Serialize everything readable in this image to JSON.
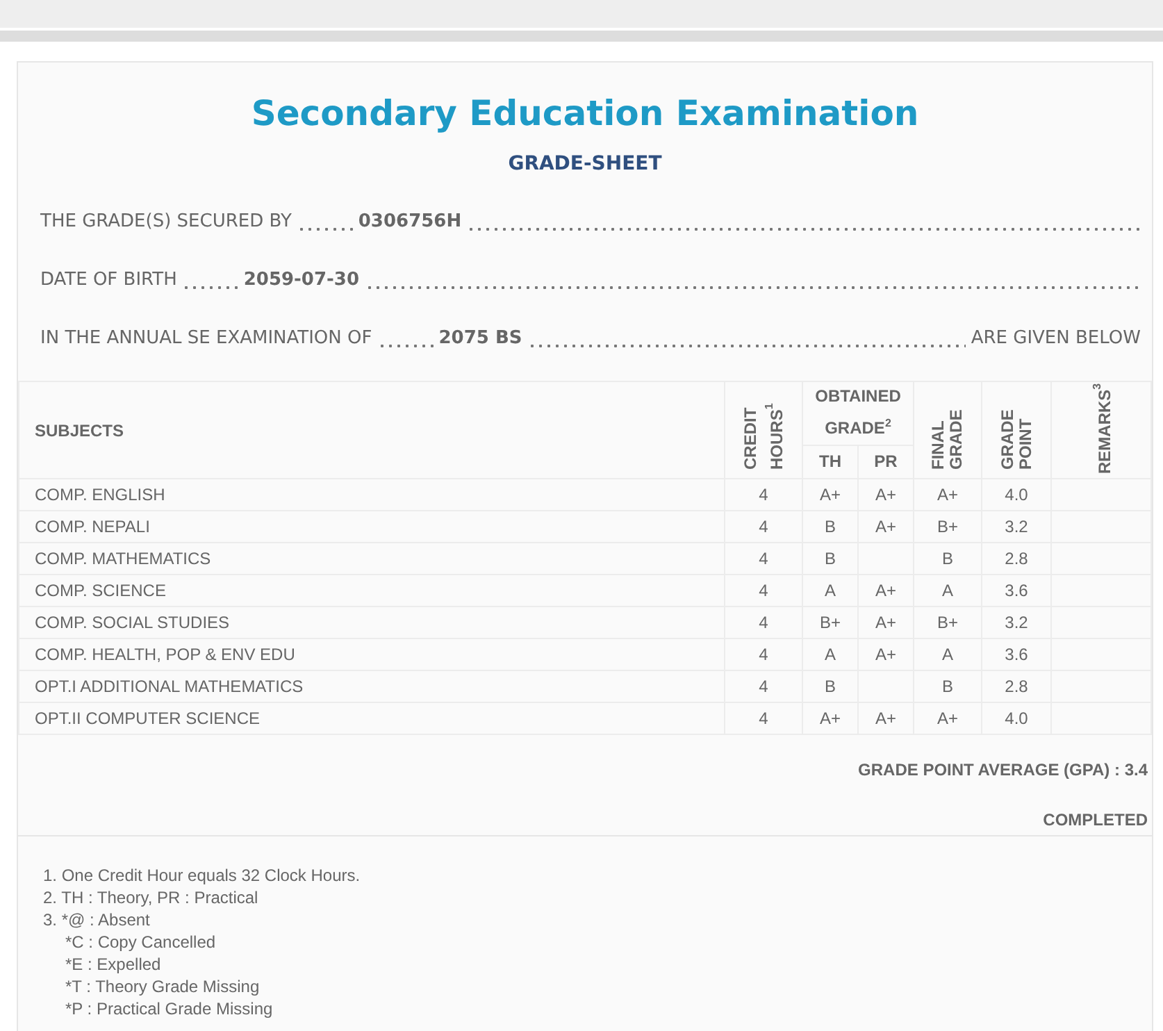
{
  "title": "Secondary Education Examination",
  "subtitle": "GRADE-SHEET",
  "info_lines": [
    {
      "label": "THE GRADE(S) SECURED BY",
      "value": "0306756H"
    },
    {
      "label": "DATE OF BIRTH",
      "value": "2059-07-30"
    },
    {
      "label": "IN THE ANNUAL SE EXAMINATION OF",
      "value": "2075 BS",
      "suffix": "ARE GIVEN BELOW"
    }
  ],
  "table": {
    "columns": {
      "subjects": "SUBJECTS",
      "credit_hours": "CREDIT HOURS$^{1}$",
      "obtained_grade": "OBTAINED GRADE$^{2}$",
      "th": "TH",
      "pr": "PR",
      "final_grade": "FINAL GRADE",
      "grade_point": "GRADE POINT",
      "remarks": "REMARKS$^{3}$"
    },
    "rows": [
      {
        "subject": "COMP. ENGLISH",
        "credit": "4",
        "th": "A+",
        "pr": "A+",
        "final": "A+",
        "gp": "4.0"
      },
      {
        "subject": "COMP. NEPALI",
        "credit": "4",
        "th": "B",
        "pr": "A+",
        "final": "B+",
        "gp": "3.2"
      },
      {
        "subject": "COMP. MATHEMATICS",
        "credit": "4",
        "th": "B",
        "final": "B",
        "gp": "2.8"
      },
      {
        "subject": "COMP. SCIENCE",
        "credit": "4",
        "th": "A",
        "pr": "A+",
        "final": "A",
        "gp": "3.6"
      },
      {
        "subject": "COMP. SOCIAL STUDIES",
        "credit": "4",
        "th": "B+",
        "pr": "A+",
        "final": "B+",
        "gp": "3.2"
      },
      {
        "subject": "COMP. HEALTH, POP & ENV EDU",
        "credit": "4",
        "th": "A",
        "pr": "A+",
        "final": "A",
        "gp": "3.6"
      },
      {
        "subject": "OPT.I ADDITIONAL MATHEMATICS",
        "credit": "4",
        "th": "B",
        "final": "B",
        "gp": "2.8"
      },
      {
        "subject": "OPT.II COMPUTER SCIENCE",
        "credit": "4",
        "th": "A+",
        "pr": "A+",
        "final": "A+",
        "gp": "4.0"
      }
    ]
  },
  "gpa": "GRADE POINT AVERAGE (GPA) : 3.4",
  "status": "COMPLETED",
  "footnotes": [
    {
      "text": "1. One Credit Hour equals 32 Clock Hours."
    },
    {
      "text": "2. TH : Theory, PR : Practical"
    },
    {
      "text": "3. *@ : Absent",
      "children": [
        {
          "text": "*C : Copy Cancelled"
        },
        {
          "text": "*E : Expelled"
        },
        {
          "text": "*T : Theory Grade Missing"
        },
        {
          "text": "*P : Practical Grade Missing"
        }
      ]
    }
  ]
}
